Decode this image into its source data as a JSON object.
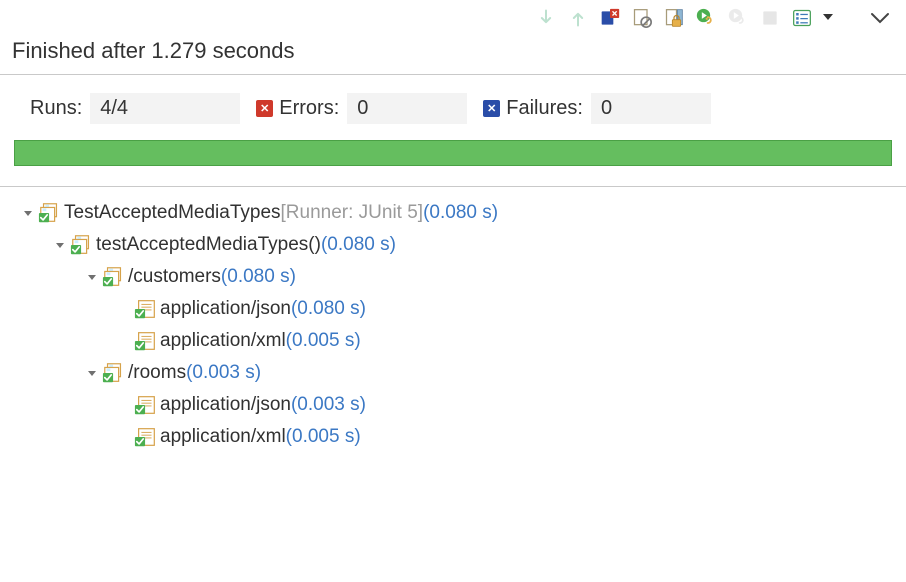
{
  "toolbar": {
    "icons": [
      {
        "name": "next-failure-icon",
        "type": "arrow-down",
        "enabled": false
      },
      {
        "name": "prev-failure-icon",
        "type": "arrow-up",
        "enabled": false
      },
      {
        "name": "show-failures-icon",
        "type": "red-x-badge",
        "enabled": true
      },
      {
        "name": "scroll-lock-icon",
        "type": "banned-page",
        "enabled": true
      },
      {
        "name": "lock-icon",
        "type": "lock-page",
        "enabled": true
      },
      {
        "name": "rerun-test-icon",
        "type": "green-play",
        "enabled": true
      },
      {
        "name": "rerun-failed-icon",
        "type": "grey-play",
        "enabled": false
      },
      {
        "name": "stop-icon",
        "type": "stop",
        "enabled": false
      },
      {
        "name": "test-history-icon",
        "type": "list",
        "enabled": true
      },
      {
        "name": "view-menu-icon",
        "type": "chevron-down",
        "enabled": true
      }
    ]
  },
  "status": {
    "text": "Finished after 1.279 seconds"
  },
  "counters": {
    "runs_label": "Runs:",
    "runs_value": "4/4",
    "errors_label": "Errors:",
    "errors_value": "0",
    "failures_label": "Failures:",
    "failures_value": "0"
  },
  "progress": {
    "color": "#65be5f",
    "percent": 100
  },
  "tree": [
    {
      "depth": 0,
      "expanded": true,
      "icon": "suite-pass",
      "text": "TestAcceptedMediaTypes",
      "suffix": " [Runner: JUnit 5]",
      "duration": "(0.080 s)"
    },
    {
      "depth": 1,
      "expanded": true,
      "icon": "suite-pass",
      "text": "testAcceptedMediaTypes()",
      "suffix": "",
      "duration": "(0.080 s)"
    },
    {
      "depth": 2,
      "expanded": true,
      "icon": "suite-pass",
      "text": "/customers",
      "suffix": "",
      "duration": "(0.080 s)"
    },
    {
      "depth": 3,
      "expanded": null,
      "icon": "test-pass",
      "text": "application/json",
      "suffix": "",
      "duration": "(0.080 s)"
    },
    {
      "depth": 3,
      "expanded": null,
      "icon": "test-pass",
      "text": "application/xml",
      "suffix": "",
      "duration": "(0.005 s)"
    },
    {
      "depth": 2,
      "expanded": true,
      "icon": "suite-pass",
      "text": "/rooms",
      "suffix": "",
      "duration": "(0.003 s)"
    },
    {
      "depth": 3,
      "expanded": null,
      "icon": "test-pass",
      "text": "application/json",
      "suffix": "",
      "duration": "(0.003 s)"
    },
    {
      "depth": 3,
      "expanded": null,
      "icon": "test-pass",
      "text": "application/xml",
      "suffix": "",
      "duration": "(0.005 s)"
    }
  ]
}
